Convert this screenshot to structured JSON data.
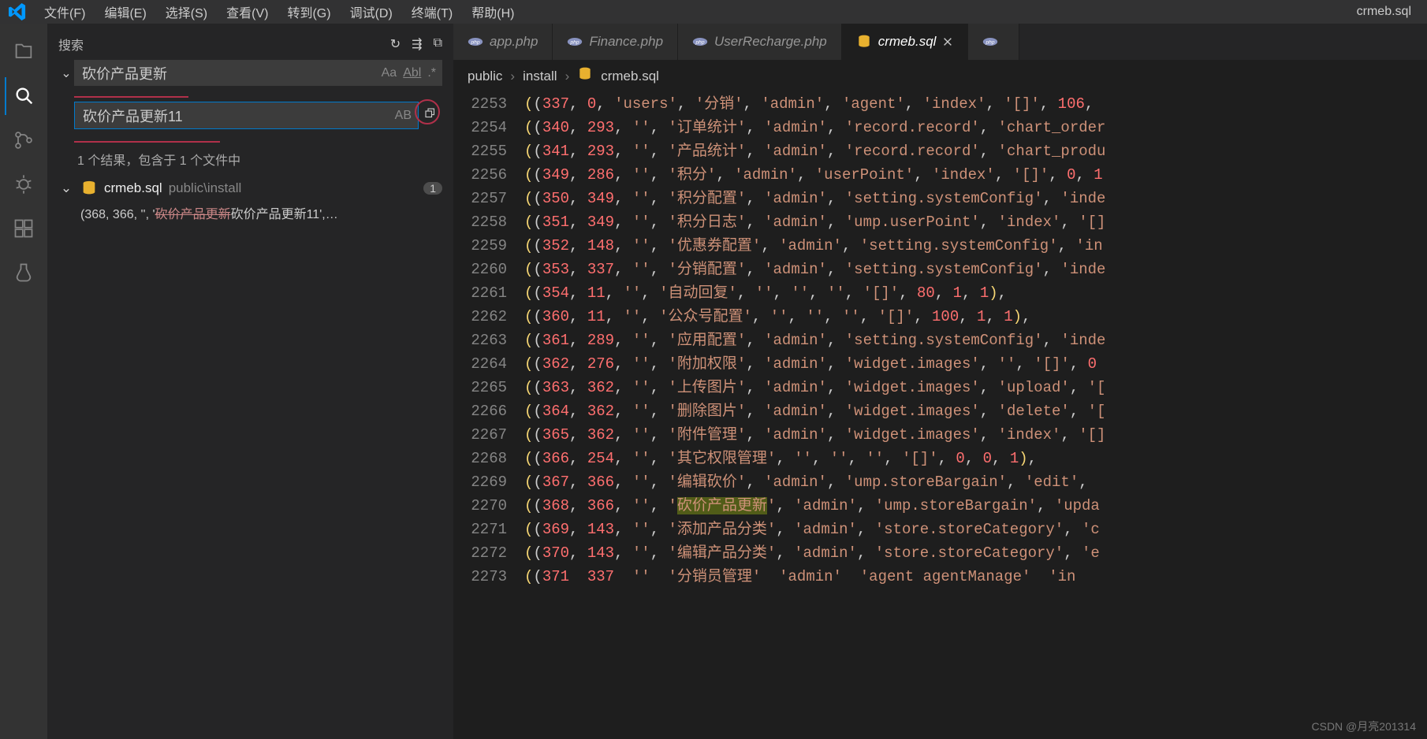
{
  "menubar": {
    "items": [
      "文件(F)",
      "编辑(E)",
      "选择(S)",
      "查看(V)",
      "转到(G)",
      "调试(D)",
      "终端(T)",
      "帮助(H)"
    ],
    "right": "crmeb.sql"
  },
  "sidebar": {
    "title": "搜索",
    "search_value": "砍价产品更新",
    "replace_value": "砍价产品更新11",
    "match_opts": {
      "case": "Aa",
      "word": "Abl",
      "regex": ".*",
      "preserve": "AB"
    },
    "result_text": "1 个结果，包含于 1 个文件中",
    "file": {
      "name": "crmeb.sql",
      "path": "public\\install",
      "badge": "1"
    },
    "line": {
      "prefix": "(368, 366, '', '",
      "old": "砍价产品更新",
      "new": "砍价产品更新11",
      "suffix": "',…"
    }
  },
  "tabs": [
    {
      "label": "app.php",
      "icon": "php"
    },
    {
      "label": "Finance.php",
      "icon": "php"
    },
    {
      "label": "UserRecharge.php",
      "icon": "php"
    },
    {
      "label": "crmeb.sql",
      "icon": "db",
      "active": true,
      "closable": true
    },
    {
      "label": "",
      "icon": "php"
    }
  ],
  "breadcrumb": [
    "public",
    "install",
    "crmeb.sql"
  ],
  "code": [
    {
      "n": 2253,
      "t": "(<r>337</r>, <r>0</r>, <s>'users'</s>, <s>'分销'</s>, <s>'admin'</s>, <s>'agent'</s>, <s>'index'</s>, <s>'[]'</s>, <r>106</r>,"
    },
    {
      "n": 2254,
      "t": "(<r>340</r>, <r>293</r>, <s>''</s>, <s>'订单统计'</s>, <s>'admin'</s>, <s>'record.record'</s>, <s>'chart_order"
    },
    {
      "n": 2255,
      "t": "(<r>341</r>, <r>293</r>, <s>''</s>, <s>'产品统计'</s>, <s>'admin'</s>, <s>'record.record'</s>, <s>'chart_produ"
    },
    {
      "n": 2256,
      "t": "(<r>349</r>, <r>286</r>, <s>''</s>, <s>'积分'</s>, <s>'admin'</s>, <s>'userPoint'</s>, <s>'index'</s>, <s>'[]'</s>, <r>0</r>, <r>1</r>"
    },
    {
      "n": 2257,
      "t": "(<r>350</r>, <r>349</r>, <s>''</s>, <s>'积分配置'</s>, <s>'admin'</s>, <s>'setting.systemConfig'</s>, <s>'inde"
    },
    {
      "n": 2258,
      "t": "(<r>351</r>, <r>349</r>, <s>''</s>, <s>'积分日志'</s>, <s>'admin'</s>, <s>'ump.userPoint'</s>, <s>'index'</s>, <s>'[]"
    },
    {
      "n": 2259,
      "t": "(<r>352</r>, <r>148</r>, <s>''</s>, <s>'优惠券配置'</s>, <s>'admin'</s>, <s>'setting.systemConfig'</s>, <s>'in"
    },
    {
      "n": 2260,
      "t": "(<r>353</r>, <r>337</r>, <s>''</s>, <s>'分销配置'</s>, <s>'admin'</s>, <s>'setting.systemConfig'</s>, <s>'inde"
    },
    {
      "n": 2261,
      "t": "(<r>354</r>, <r>11</r>, <s>''</s>, <s>'自动回复'</s>, <s>''</s>, <s>''</s>, <s>''</s>, <s>'[]'</s>, <r>80</r>, <r>1</r>, <r>1</r>),"
    },
    {
      "n": 2262,
      "t": "(<r>360</r>, <r>11</r>, <s>''</s>, <s>'公众号配置'</s>, <s>''</s>, <s>''</s>, <s>''</s>, <s>'[]'</s>, <r>100</r>, <r>1</r>, <r>1</r>),"
    },
    {
      "n": 2263,
      "t": "(<r>361</r>, <r>289</r>, <s>''</s>, <s>'应用配置'</s>, <s>'admin'</s>, <s>'setting.systemConfig'</s>, <s>'inde"
    },
    {
      "n": 2264,
      "t": "(<r>362</r>, <r>276</r>, <s>''</s>, <s>'附加权限'</s>, <s>'admin'</s>, <s>'widget.images'</s>, <s>''</s>, <s>'[]'</s>, <r>0</r>"
    },
    {
      "n": 2265,
      "t": "(<r>363</r>, <r>362</r>, <s>''</s>, <s>'上传图片'</s>, <s>'admin'</s>, <s>'widget.images'</s>, <s>'upload'</s>, <s>'["
    },
    {
      "n": 2266,
      "t": "(<r>364</r>, <r>362</r>, <s>''</s>, <s>'删除图片'</s>, <s>'admin'</s>, <s>'widget.images'</s>, <s>'delete'</s>, <s>'["
    },
    {
      "n": 2267,
      "t": "(<r>365</r>, <r>362</r>, <s>''</s>, <s>'附件管理'</s>, <s>'admin'</s>, <s>'widget.images'</s>, <s>'index'</s>, <s>'[]"
    },
    {
      "n": 2268,
      "t": "(<r>366</r>, <r>254</r>, <s>''</s>, <s>'其它权限管理'</s>, <s>''</s>, <s>''</s>, <s>''</s>, <s>'[]'</s>, <r>0</r>, <r>0</r>, <r>1</r>),"
    },
    {
      "n": 2269,
      "t": "(<r>367</r>, <r>366</r>, <s>''</s>, <s>'编辑砍价'</s>, <s>'admin'</s>, <s>'ump.storeBargain'</s>, <s>'edit'</s>, "
    },
    {
      "n": 2270,
      "t": "(<r>368</r>, <r>366</r>, <s>''</s>, <s>'<hl>砍价产品更新</hl>'</s>, <s>'admin'</s>, <s>'ump.storeBargain'</s>, <s>'upda",
      "hl": true
    },
    {
      "n": 2271,
      "t": "(<r>369</r>, <r>143</r>, <s>''</s>, <s>'添加产品分类'</s>, <s>'admin'</s>, <s>'store.storeCategory'</s>, <s>'c"
    },
    {
      "n": 2272,
      "t": "(<r>370</r>, <r>143</r>, <s>''</s>, <s>'编辑产品分类'</s>, <s>'admin'</s>, <s>'store.storeCategory'</s>, <s>'e"
    },
    {
      "n": 2273,
      "t": "(<r>371</r>  <r>337</r>  <s>''</s>  <s>'分销员管理'</s>  <s>'admin'</s>  <s>'agent agentManage'</s>  <s>'in"
    }
  ],
  "watermark": "CSDN @月亮201314"
}
